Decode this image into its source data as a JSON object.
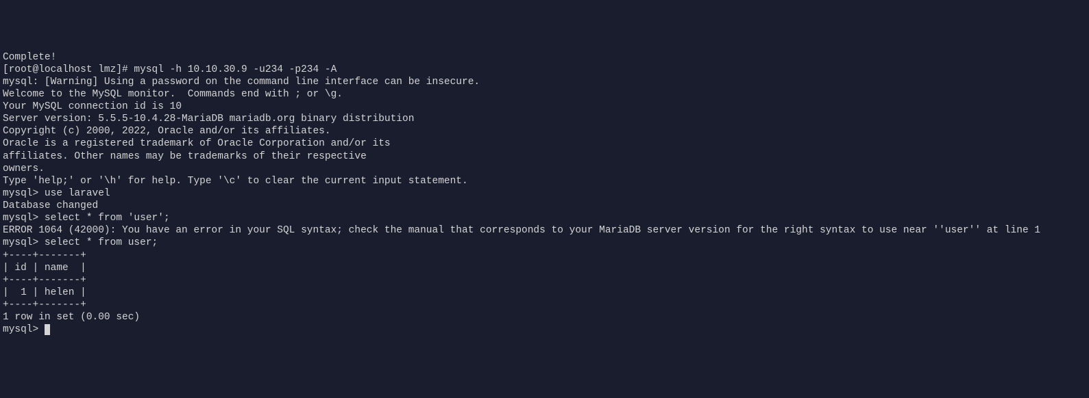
{
  "terminal": {
    "lines": [
      "Complete!",
      "[root@localhost lmz]# mysql -h 10.10.30.9 -u234 -p234 -A",
      "mysql: [Warning] Using a password on the command line interface can be insecure.",
      "Welcome to the MySQL monitor.  Commands end with ; or \\g.",
      "Your MySQL connection id is 10",
      "Server version: 5.5.5-10.4.28-MariaDB mariadb.org binary distribution",
      "",
      "Copyright (c) 2000, 2022, Oracle and/or its affiliates.",
      "",
      "Oracle is a registered trademark of Oracle Corporation and/or its",
      "affiliates. Other names may be trademarks of their respective",
      "owners.",
      "",
      "Type 'help;' or '\\h' for help. Type '\\c' to clear the current input statement.",
      "",
      "mysql> use laravel",
      "Database changed",
      "mysql> select * from 'user';",
      "ERROR 1064 (42000): You have an error in your SQL syntax; check the manual that corresponds to your MariaDB server version for the right syntax to use near ''user'' at line 1",
      "mysql> select * from user;",
      "+----+-------+",
      "| id | name  |",
      "+----+-------+",
      "|  1 | helen |",
      "+----+-------+",
      "1 row in set (0.00 sec)",
      "",
      "mysql> "
    ]
  }
}
